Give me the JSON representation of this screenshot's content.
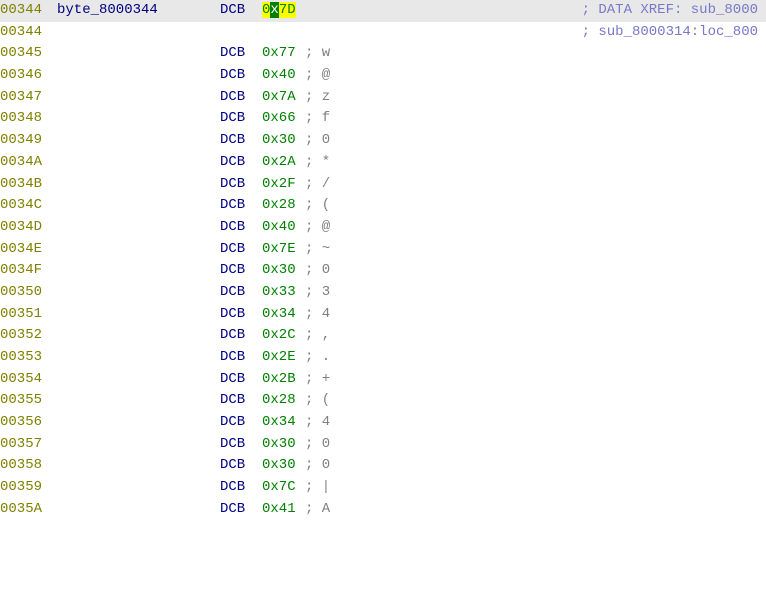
{
  "lines": [
    {
      "addr": "00344",
      "label": "byte_8000344",
      "mn": "DCB",
      "op_pre": "0",
      "op_mid": "x",
      "op_post": "7D",
      "hl": true,
      "sc": "",
      "ascii": "",
      "xref": "; DATA XREF: sub_8000"
    },
    {
      "addr": "00344",
      "label": "",
      "mn": "",
      "op_pre": "",
      "op_mid": "",
      "op_post": "",
      "hl": false,
      "sc": "",
      "ascii": "",
      "xref": "; sub_8000314:loc_800"
    },
    {
      "addr": "00345",
      "label": "",
      "mn": "DCB",
      "op_pre": "0x77",
      "op_mid": "",
      "op_post": "",
      "hl": false,
      "sc": ";",
      "ascii": " w",
      "xref": ""
    },
    {
      "addr": "00346",
      "label": "",
      "mn": "DCB",
      "op_pre": "0x40",
      "op_mid": "",
      "op_post": "",
      "hl": false,
      "sc": ";",
      "ascii": " @",
      "xref": ""
    },
    {
      "addr": "00347",
      "label": "",
      "mn": "DCB",
      "op_pre": "0x7A",
      "op_mid": "",
      "op_post": "",
      "hl": false,
      "sc": ";",
      "ascii": " z",
      "xref": ""
    },
    {
      "addr": "00348",
      "label": "",
      "mn": "DCB",
      "op_pre": "0x66",
      "op_mid": "",
      "op_post": "",
      "hl": false,
      "sc": ";",
      "ascii": " f",
      "xref": ""
    },
    {
      "addr": "00349",
      "label": "",
      "mn": "DCB",
      "op_pre": "0x30",
      "op_mid": "",
      "op_post": "",
      "hl": false,
      "sc": ";",
      "ascii": " 0",
      "xref": ""
    },
    {
      "addr": "0034A",
      "label": "",
      "mn": "DCB",
      "op_pre": "0x2A",
      "op_mid": "",
      "op_post": "",
      "hl": false,
      "sc": ";",
      "ascii": " *",
      "xref": ""
    },
    {
      "addr": "0034B",
      "label": "",
      "mn": "DCB",
      "op_pre": "0x2F",
      "op_mid": "",
      "op_post": "",
      "hl": false,
      "sc": ";",
      "ascii": " /",
      "xref": ""
    },
    {
      "addr": "0034C",
      "label": "",
      "mn": "DCB",
      "op_pre": "0x28",
      "op_mid": "",
      "op_post": "",
      "hl": false,
      "sc": ";",
      "ascii": " (",
      "xref": ""
    },
    {
      "addr": "0034D",
      "label": "",
      "mn": "DCB",
      "op_pre": "0x40",
      "op_mid": "",
      "op_post": "",
      "hl": false,
      "sc": ";",
      "ascii": " @",
      "xref": ""
    },
    {
      "addr": "0034E",
      "label": "",
      "mn": "DCB",
      "op_pre": "0x7E",
      "op_mid": "",
      "op_post": "",
      "hl": false,
      "sc": ";",
      "ascii": " ~",
      "xref": ""
    },
    {
      "addr": "0034F",
      "label": "",
      "mn": "DCB",
      "op_pre": "0x30",
      "op_mid": "",
      "op_post": "",
      "hl": false,
      "sc": ";",
      "ascii": " 0",
      "xref": ""
    },
    {
      "addr": "00350",
      "label": "",
      "mn": "DCB",
      "op_pre": "0x33",
      "op_mid": "",
      "op_post": "",
      "hl": false,
      "sc": ";",
      "ascii": " 3",
      "xref": ""
    },
    {
      "addr": "00351",
      "label": "",
      "mn": "DCB",
      "op_pre": "0x34",
      "op_mid": "",
      "op_post": "",
      "hl": false,
      "sc": ";",
      "ascii": " 4",
      "xref": ""
    },
    {
      "addr": "00352",
      "label": "",
      "mn": "DCB",
      "op_pre": "0x2C",
      "op_mid": "",
      "op_post": "",
      "hl": false,
      "sc": ";",
      "ascii": " ,",
      "xref": ""
    },
    {
      "addr": "00353",
      "label": "",
      "mn": "DCB",
      "op_pre": "0x2E",
      "op_mid": "",
      "op_post": "",
      "hl": false,
      "sc": ";",
      "ascii": " .",
      "xref": ""
    },
    {
      "addr": "00354",
      "label": "",
      "mn": "DCB",
      "op_pre": "0x2B",
      "op_mid": "",
      "op_post": "",
      "hl": false,
      "sc": ";",
      "ascii": " +",
      "xref": ""
    },
    {
      "addr": "00355",
      "label": "",
      "mn": "DCB",
      "op_pre": "0x28",
      "op_mid": "",
      "op_post": "",
      "hl": false,
      "sc": ";",
      "ascii": " (",
      "xref": ""
    },
    {
      "addr": "00356",
      "label": "",
      "mn": "DCB",
      "op_pre": "0x34",
      "op_mid": "",
      "op_post": "",
      "hl": false,
      "sc": ";",
      "ascii": " 4",
      "xref": ""
    },
    {
      "addr": "00357",
      "label": "",
      "mn": "DCB",
      "op_pre": "0x30",
      "op_mid": "",
      "op_post": "",
      "hl": false,
      "sc": ";",
      "ascii": " 0",
      "xref": ""
    },
    {
      "addr": "00358",
      "label": "",
      "mn": "DCB",
      "op_pre": "0x30",
      "op_mid": "",
      "op_post": "",
      "hl": false,
      "sc": ";",
      "ascii": " 0",
      "xref": ""
    },
    {
      "addr": "00359",
      "label": "",
      "mn": "DCB",
      "op_pre": "0x7C",
      "op_mid": "",
      "op_post": "",
      "hl": false,
      "sc": ";",
      "ascii": " |",
      "xref": ""
    },
    {
      "addr": "0035A",
      "label": "",
      "mn": "DCB",
      "op_pre": "0x41",
      "op_mid": "",
      "op_post": "",
      "hl": false,
      "sc": ";",
      "ascii": " A",
      "xref": ""
    }
  ]
}
